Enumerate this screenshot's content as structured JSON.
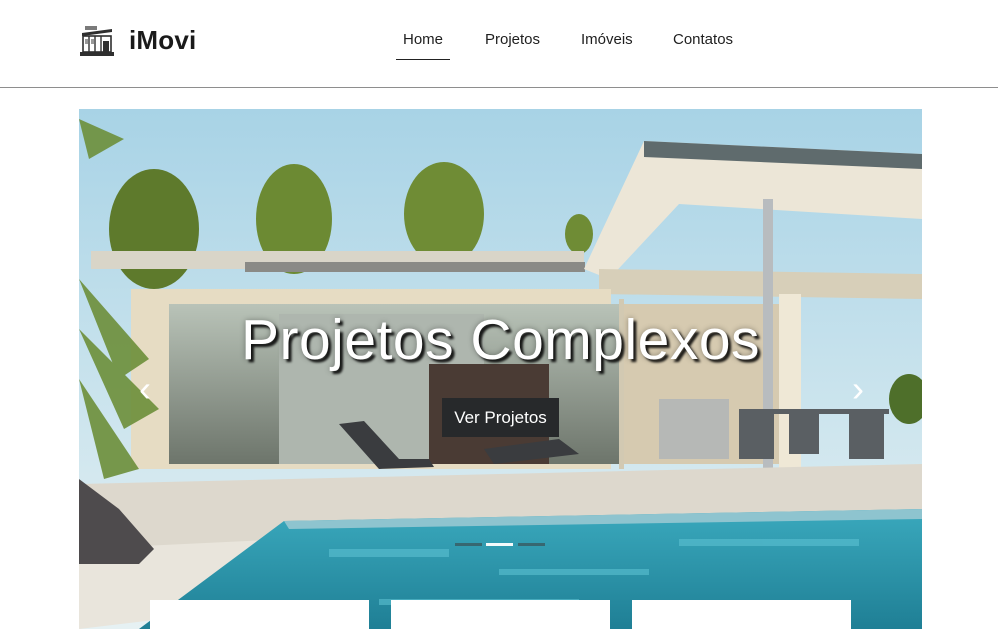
{
  "header": {
    "brand_name": "iMovi",
    "nav": [
      {
        "label": "Home",
        "active": true
      },
      {
        "label": "Projetos",
        "active": false
      },
      {
        "label": "Imóveis",
        "active": false
      },
      {
        "label": "Contatos",
        "active": false
      }
    ]
  },
  "hero": {
    "title": "Projetos Complexos",
    "button_label": "Ver Projetos",
    "prev_arrow": "‹",
    "next_arrow": "›",
    "slides": 3,
    "active_slide": 2
  },
  "icons": {
    "brand": "house-icon",
    "prev": "chevron-left-icon",
    "next": "chevron-right-icon"
  },
  "colors": {
    "button_bg": "#27292b",
    "header_border": "#8e8e8e",
    "pool": "#2a9bb0"
  }
}
